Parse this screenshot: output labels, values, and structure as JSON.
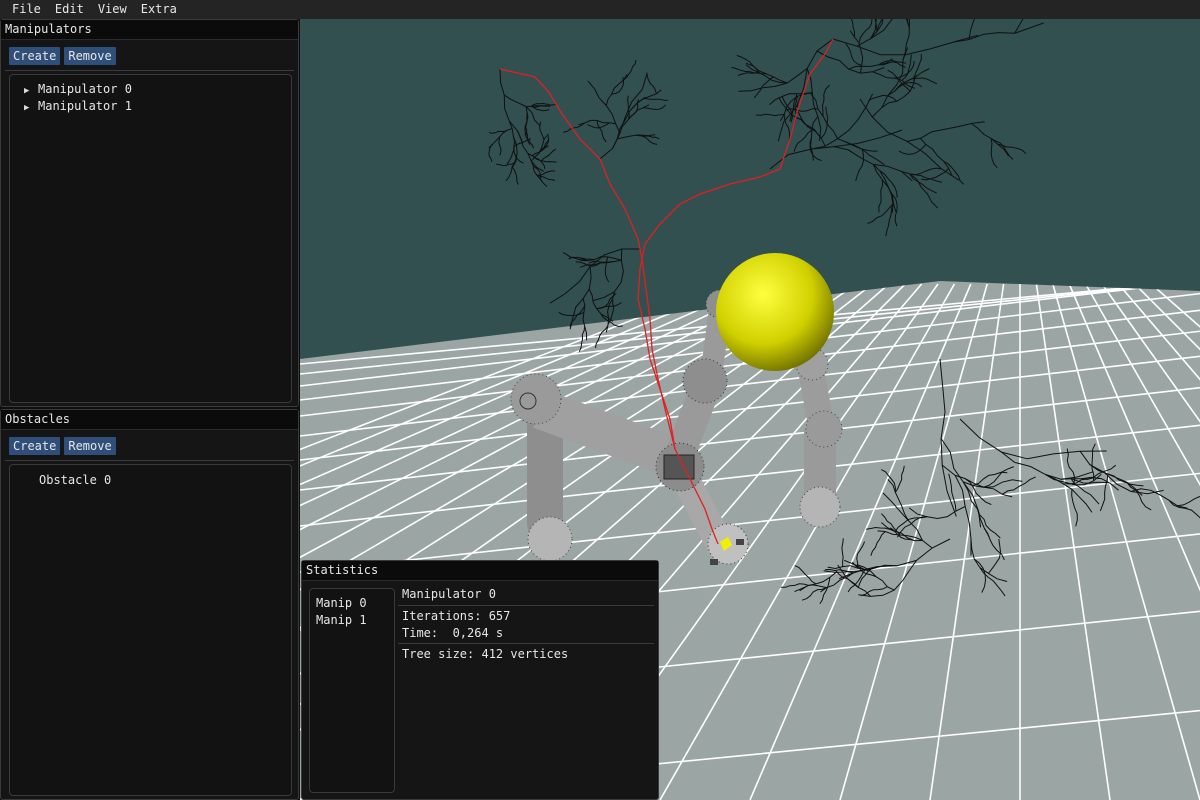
{
  "menubar": {
    "items": [
      "File",
      "Edit",
      "View",
      "Extra"
    ]
  },
  "manipulators_panel": {
    "title": "Manipulators",
    "create_label": "Create",
    "remove_label": "Remove",
    "items": [
      "Manipulator 0",
      "Manipulator 1"
    ]
  },
  "obstacles_panel": {
    "title": "Obstacles",
    "create_label": "Create",
    "remove_label": "Remove",
    "items": [
      "Obstacle 0"
    ]
  },
  "statistics_panel": {
    "title": "Statistics",
    "list": [
      "Manip 0",
      "Manip 1"
    ],
    "selected_title": "Manipulator 0",
    "iterations": "Iterations: 657",
    "time": "Time:  0,264 s",
    "tree_size": "Tree size: 412 vertices"
  },
  "scene": {
    "background_color": "#325050",
    "floor_color": "#9aa5a4",
    "grid_color": "#ffffff",
    "obstacle_color": "#d4d400",
    "path_color": "#e02020",
    "tree_color": "#101010",
    "arm_color": "#a6a6a6"
  }
}
